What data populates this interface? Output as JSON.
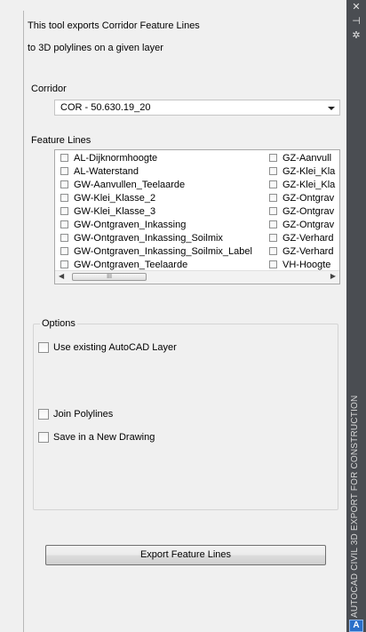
{
  "intro": {
    "line1": "This tool exports Corridor Feature Lines",
    "line2": "to 3D polylines on a given layer"
  },
  "corridor": {
    "label": "Corridor",
    "selected": "COR - 50.630.19_20"
  },
  "feature_lines": {
    "label": "Feature Lines",
    "column1": [
      "AL-Dijknormhoogte",
      "AL-Waterstand",
      "GW-Aanvullen_Teelaarde",
      "GW-Klei_Klasse_2",
      "GW-Klei_Klasse_3",
      "GW-Ontgraven_Inkassing",
      "GW-Ontgraven_Inkassing_Soilmix",
      "GW-Ontgraven_Inkassing_Soilmix_Label",
      "GW-Ontgraven_Teelaarde"
    ],
    "column2": [
      "GZ-Aanvull",
      "GZ-Klei_Kla",
      "GZ-Klei_Kla",
      "GZ-Ontgrav",
      "GZ-Ontgrav",
      "GZ-Ontgrav",
      "GZ-Verhard",
      "GZ-Verhard",
      "VH-Hoogte"
    ],
    "scroll_left": "◀",
    "scroll_right": "▶",
    "thumb_grip": "III"
  },
  "options": {
    "label": "Options",
    "use_existing_layer": "Use existing AutoCAD Layer",
    "join_polylines": "Join  Polylines",
    "save_new_drawing": "Save in a New Drawing"
  },
  "export_button": "Export Feature Lines",
  "side_bar": {
    "title": "AUTOCAD CIVIL 3D EXPORT FOR CONSTRUCTION",
    "close": "✕",
    "pin": "⊣",
    "settings": "✲",
    "logo": "A"
  }
}
